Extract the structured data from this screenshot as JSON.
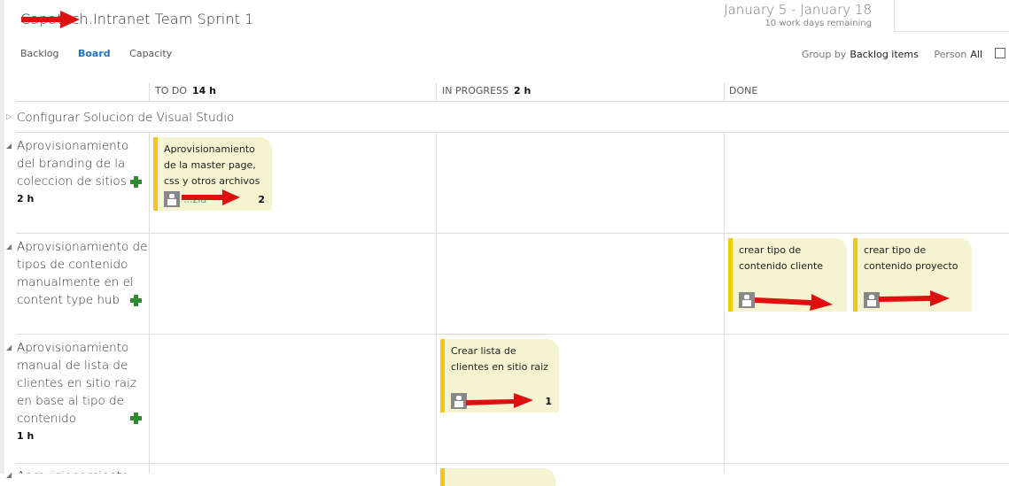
{
  "header": {
    "title": "Capatech.Intranet Team Sprint 1",
    "date_range": "January 5 - January 18",
    "days_remaining": "10 work days remaining"
  },
  "tabs": [
    {
      "label": "Backlog",
      "active": false
    },
    {
      "label": "Board",
      "active": true
    },
    {
      "label": "Capacity",
      "active": false
    }
  ],
  "toolbar": {
    "group_by_label": "Group by",
    "group_by_value": "Backlog items",
    "person_label": "Person",
    "person_value": "All"
  },
  "columns": [
    {
      "name": "TO DO",
      "hours": "14 h"
    },
    {
      "name": "IN PROGRESS",
      "hours": "2 h"
    },
    {
      "name": "DONE",
      "hours": ""
    }
  ],
  "rows": [
    {
      "title": "Configurar Solucion de Visual Studio",
      "hours": "",
      "collapsed": true
    },
    {
      "title": "Aprovisionamiento del branding de la coleccion de sitios",
      "hours": "2 h",
      "collapsed": false
    },
    {
      "title": "Aprovisionamiento de tipos de contenido manualmente en el content type hub",
      "hours": "",
      "collapsed": false
    },
    {
      "title": "Aprovisionamiento manual de lista de clientes en sitio raiz en base al tipo de contenido",
      "hours": "1 h",
      "collapsed": false
    },
    {
      "title": "Aprovisionamiento de ...",
      "hours": "",
      "collapsed": false
    }
  ],
  "cards": [
    {
      "row": 1,
      "column": "TO DO",
      "title": "Aprovisionamiento de la master page, css y otros archivos",
      "assignee": "...zia",
      "remaining": "2"
    },
    {
      "row": 2,
      "column": "DONE",
      "title": "crear tipo de contenido cliente",
      "assignee": "",
      "remaining": ""
    },
    {
      "row": 2,
      "column": "DONE",
      "title": "crear tipo de contenido proyecto",
      "assignee": "",
      "remaining": ""
    },
    {
      "row": 3,
      "column": "IN PROGRESS",
      "title": "Crear lista de clientes en sitio raiz",
      "assignee": "",
      "remaining": "1"
    }
  ]
}
